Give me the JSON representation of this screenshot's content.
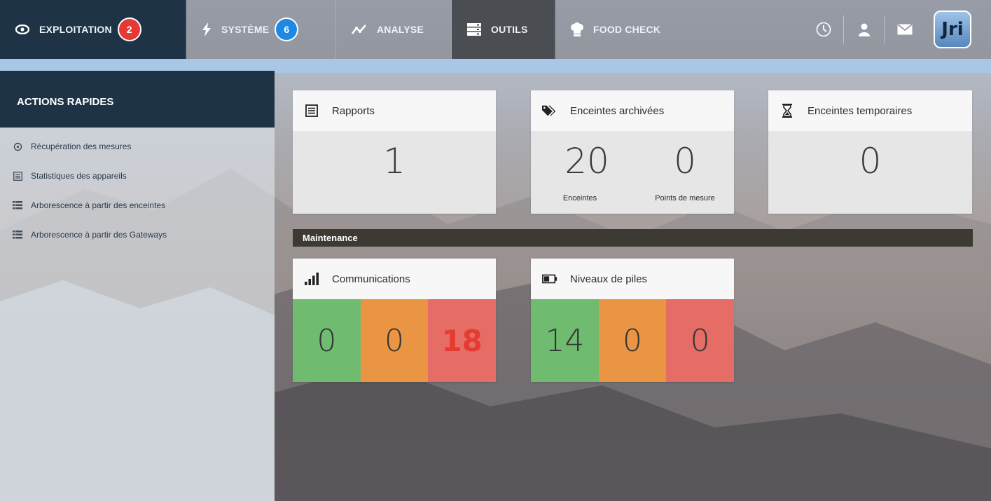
{
  "nav": {
    "tabs": [
      {
        "label": "EXPLOITATION",
        "icon": "eye-icon",
        "badge": "2",
        "badge_color": "#e53935"
      },
      {
        "label": "SYSTÈME",
        "icon": "lightning-icon",
        "badge": "6",
        "badge_color": "#1e88e5"
      },
      {
        "label": "ANALYSE",
        "icon": "trend-icon"
      },
      {
        "label": "OUTILS",
        "icon": "server-icon"
      },
      {
        "label": "FOOD CHECK",
        "icon": "chef-hat-icon"
      }
    ],
    "right_icons": [
      "clock-icon",
      "user-icon",
      "mail-icon"
    ],
    "logo_text": "Jri"
  },
  "sidebar": {
    "title": "ACTIONS RAPIDES",
    "items": [
      {
        "label": "Récupération des mesures",
        "icon": "refresh-icon"
      },
      {
        "label": "Statistiques des appareils",
        "icon": "list-box-icon"
      },
      {
        "label": "Arborescence à partir des enceintes",
        "icon": "list-icon"
      },
      {
        "label": "Arborescence à partir des Gateways",
        "icon": "list-icon"
      }
    ]
  },
  "cards": {
    "rapports": {
      "title": "Rapports",
      "value": "1",
      "icon": "list-box-icon"
    },
    "archivees": {
      "title": "Enceintes archivées",
      "value_enceintes": "20",
      "label_enceintes": "Enceintes",
      "value_points": "0",
      "label_points": "Points de mesure",
      "icon": "tags-icon"
    },
    "temporaires": {
      "title": "Enceintes temporaires",
      "value": "0",
      "icon": "hourglass-icon"
    }
  },
  "maintenance": {
    "title": "Maintenance",
    "communications": {
      "title": "Communications",
      "icon": "signal-icon",
      "values": [
        "0",
        "0",
        "18"
      ]
    },
    "piles": {
      "title": "Niveaux de piles",
      "icon": "battery-icon",
      "values": [
        "14",
        "0",
        "0"
      ]
    }
  },
  "colors": {
    "nav_dark": "#1e3346",
    "green": "#6fbb70",
    "orange": "#e99544",
    "red": "#e66d66",
    "alert_text": "#e63b30"
  }
}
